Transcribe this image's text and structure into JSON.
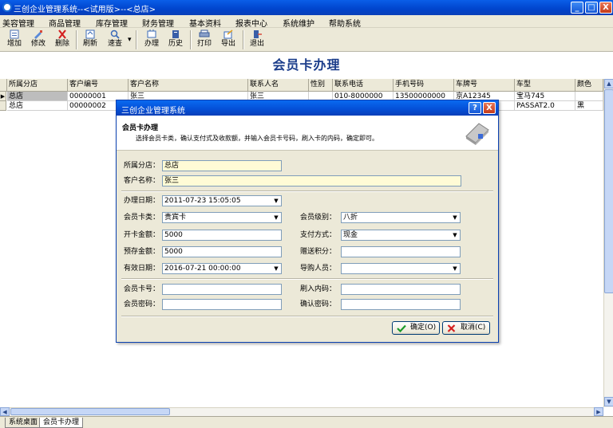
{
  "app": {
    "title": "三创企业管理系统--<试用版>--<总店>",
    "win_min": "_",
    "win_max": "□",
    "win_close": "X"
  },
  "menu": [
    "美容管理",
    "商品管理",
    "库存管理",
    "财务管理",
    "基本资料",
    "报表中心",
    "系统维护",
    "帮助系统"
  ],
  "toolbar": {
    "add": "增加",
    "edit": "修改",
    "delete": "删除",
    "refresh": "刷新",
    "quick_search": "速查",
    "dropdown": "▾",
    "process": "办理",
    "history": "历史",
    "print": "打印",
    "export": "导出",
    "exit": "退出"
  },
  "page_title": "会员卡办理",
  "grid": {
    "headers": [
      "所属分店",
      "客户编号",
      "客户名称",
      "联系人名",
      "性别",
      "联系电话",
      "手机号码",
      "车牌号",
      "车型",
      "颜色"
    ],
    "rows": [
      [
        "总店",
        "00000001",
        "张三",
        "张三",
        "",
        "010-8000000",
        "13500000000",
        "京A12345",
        "宝马745",
        ""
      ],
      [
        "总店",
        "00000002",
        "",
        "",
        "",
        "",
        "",
        "",
        "PASSAT2.0",
        "黑"
      ]
    ],
    "row_marker": "▶"
  },
  "scroll": {
    "up": "▲",
    "down": "▼",
    "left": "◀",
    "right": "▶"
  },
  "tabs": [
    "系统桌面",
    "会员卡办理"
  ],
  "dialog": {
    "title": "三创企业管理系统",
    "help": "?",
    "close": "X",
    "heading": "会员卡办理",
    "instructions": "选择会员卡类，确认支付式及收款额，并输入会员卡号码，刷入卡的内码，确定即可。",
    "fields": {
      "branch_label": "所属分店：",
      "branch_value": "总店",
      "customer_label": "客户名称：",
      "customer_value": "张三",
      "date_label": "办理日期：",
      "date_value": "2011-07-23 15:05:05",
      "card_type_label": "会员卡类：",
      "card_type_value": "贵宾卡",
      "level_label": "会员级别：",
      "level_value": "八折",
      "open_amount_label": "开卡金额：",
      "open_amount_value": "5000",
      "pay_method_label": "支付方式：",
      "pay_method_value": "现金",
      "deposit_label": "预存金额：",
      "deposit_value": "5000",
      "points_label": "赠送积分：",
      "points_value": "",
      "expiry_label": "有效日期：",
      "expiry_value": "2016-07-21 00:00:00",
      "guide_label": "导购人员：",
      "guide_value": "",
      "card_no_label": "会员卡号：",
      "card_no_value": "",
      "inner_code_label": "刷入内码：",
      "inner_code_value": "",
      "password_label": "会员密码：",
      "password_value": "",
      "confirm_pwd_label": "确认密码：",
      "confirm_pwd_value": ""
    },
    "ok": "确定(O)",
    "cancel": "取消(C)",
    "dd_arrow": "▼"
  }
}
